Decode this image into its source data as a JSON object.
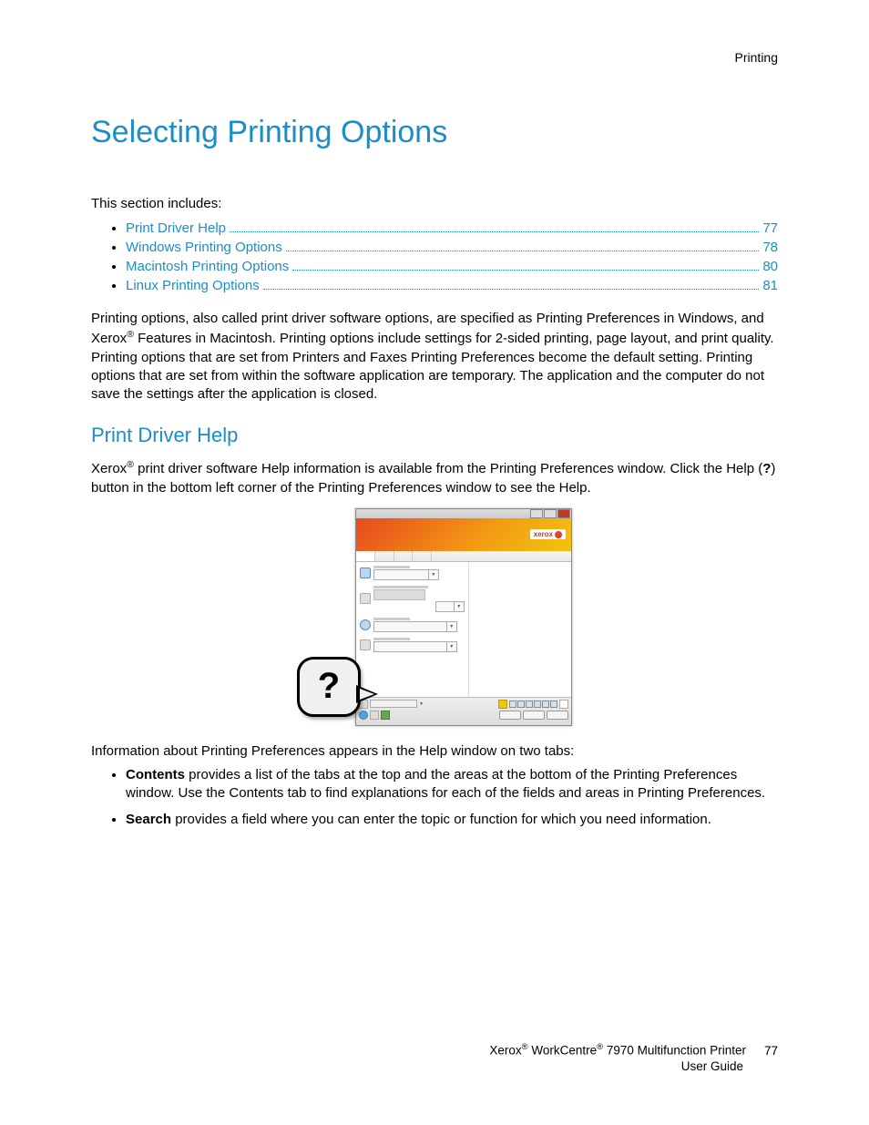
{
  "running_head": "Printing",
  "title": "Selecting Printing Options",
  "intro": "This section includes:",
  "toc": [
    {
      "label": "Print Driver Help",
      "page": "77"
    },
    {
      "label": "Windows Printing Options",
      "page": "78"
    },
    {
      "label": "Macintosh Printing Options",
      "page": "80"
    },
    {
      "label": "Linux Printing Options",
      "page": "81"
    }
  ],
  "para1_a": "Printing options, also called print driver software options, are specified as Printing Preferences in Windows, and Xerox",
  "para1_b": " Features in Macintosh. Printing options include settings for 2-sided printing, page layout, and print quality. Printing options that are set from Printers and Faxes Printing Preferences become the default setting. Printing options that are set from within the software application are temporary. The application and the computer do not save the settings after the application is closed.",
  "subhead": "Print Driver Help",
  "para2_a": "Xerox",
  "para2_b": " print driver software Help information is available from the Printing Preferences window. Click the Help (",
  "para2_q": "?",
  "para2_c": ") button in the bottom left corner of the Printing Preferences window to see the Help.",
  "figure": {
    "logo": "xerox",
    "help_mark": "?"
  },
  "para3": "Information about Printing Preferences appears in the Help window on two tabs:",
  "bullets": {
    "b1_bold": "Contents",
    "b1_rest": " provides a list of the tabs at the top and the areas at the bottom of the Printing Preferences window. Use the Contents tab to find explanations for each of the fields and areas in Printing Preferences.",
    "b2_bold": "Search",
    "b2_rest": " provides a field where you can enter the topic or function for which you need information."
  },
  "footer": {
    "line1_a": "Xerox",
    "line1_b": " WorkCentre",
    "line1_c": " 7970 Multifunction Printer",
    "page": "77",
    "line2": "User Guide"
  },
  "reg": "®"
}
